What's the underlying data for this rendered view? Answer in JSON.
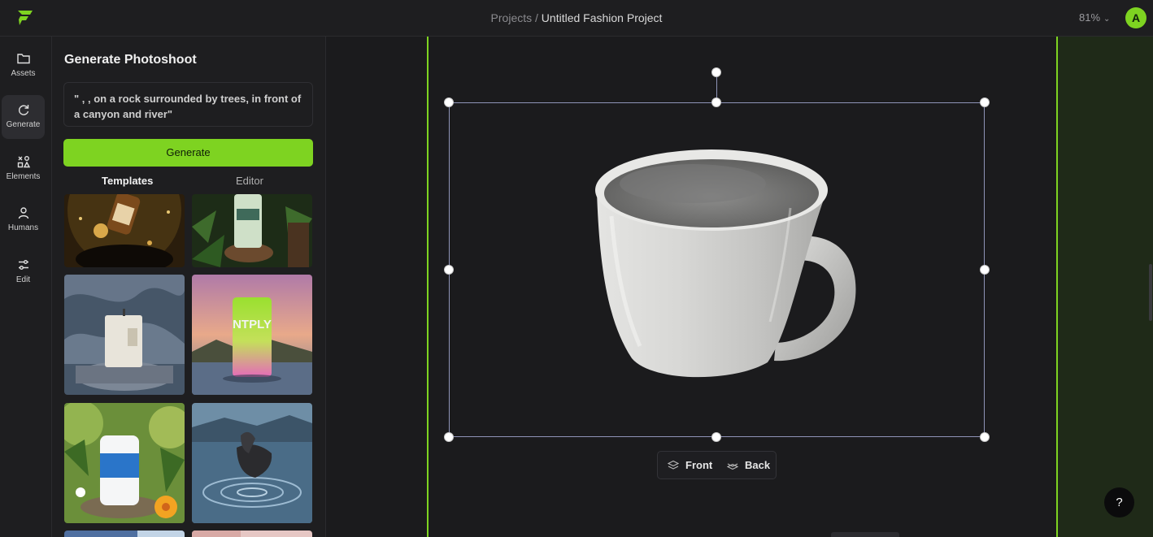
{
  "header": {
    "logo_icon": "brand-logo-icon",
    "breadcrumb_parent": "Projects",
    "breadcrumb_separator": " / ",
    "project_name": "Untitled Fashion Project",
    "zoom_level": "81%",
    "avatar_initial": "A"
  },
  "rail": {
    "items": [
      {
        "label": "Assets",
        "icon": "folder-icon"
      },
      {
        "label": "Generate",
        "icon": "refresh-icon",
        "active": true
      },
      {
        "label": "Elements",
        "icon": "elements-icon"
      },
      {
        "label": "Humans",
        "icon": "person-icon"
      },
      {
        "label": "Edit",
        "icon": "sliders-icon"
      }
    ]
  },
  "panel": {
    "title": "Generate Photoshoot",
    "prompt_text": "\" , , on a rock surrounded by trees, in front of a canyon and river\"",
    "generate_label": "Generate",
    "tabs": [
      {
        "label": "Templates",
        "active": true
      },
      {
        "label": "Editor",
        "active": false
      }
    ]
  },
  "canvas": {
    "layer_controls": {
      "front_label": "Front",
      "back_label": "Back"
    },
    "product": "white ceramic mug",
    "help_label": "?"
  },
  "colors": {
    "accent": "#7ed321",
    "background": "#1b1b1d",
    "panel": "#1e1e20",
    "selection": "#8f94b8"
  }
}
